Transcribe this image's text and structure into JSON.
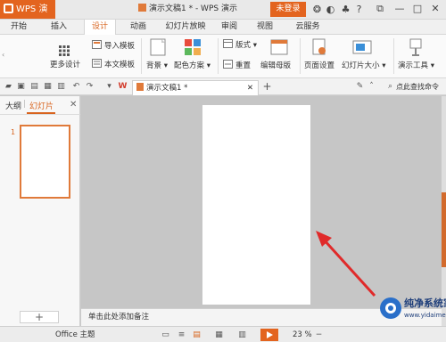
{
  "app": {
    "name": "WPS 演示"
  },
  "window": {
    "title": "演示文稿1 * - WPS 演示",
    "login_label": "未登录"
  },
  "tabs": [
    {
      "label": "开始"
    },
    {
      "label": "插入"
    },
    {
      "label": "设计",
      "active": true
    },
    {
      "label": "动画"
    },
    {
      "label": "幻灯片放映"
    },
    {
      "label": "审阅"
    },
    {
      "label": "视图"
    },
    {
      "label": "云服务"
    }
  ],
  "ribbon": {
    "more_design": "更多设计",
    "import_template": "导入模板",
    "text_template": "本文模板",
    "background": "背景",
    "color_scheme": "配色方案",
    "layout": "版式",
    "reset": "重置",
    "edit_master": "编辑母版",
    "page_setup": "页面设置",
    "slide_size": "幻灯片大小",
    "presentation_tools": "演示工具"
  },
  "quickbar": {
    "doc_tab": "演示文稿1 *",
    "search_placeholder": "点此查找命令"
  },
  "left_pane": {
    "tab_outline": "大纲",
    "tab_slides": "幻灯片",
    "slide_number": "1",
    "add_label": "+"
  },
  "notes": {
    "placeholder": "单击此处添加备注"
  },
  "status": {
    "theme": "Office 主题",
    "zoom": "23 %"
  },
  "watermark": {
    "title": "纯净系统家园",
    "url": "www.yidaimei.com"
  },
  "colors": {
    "accent": "#E3641F",
    "active_tab": "#D8631D"
  }
}
